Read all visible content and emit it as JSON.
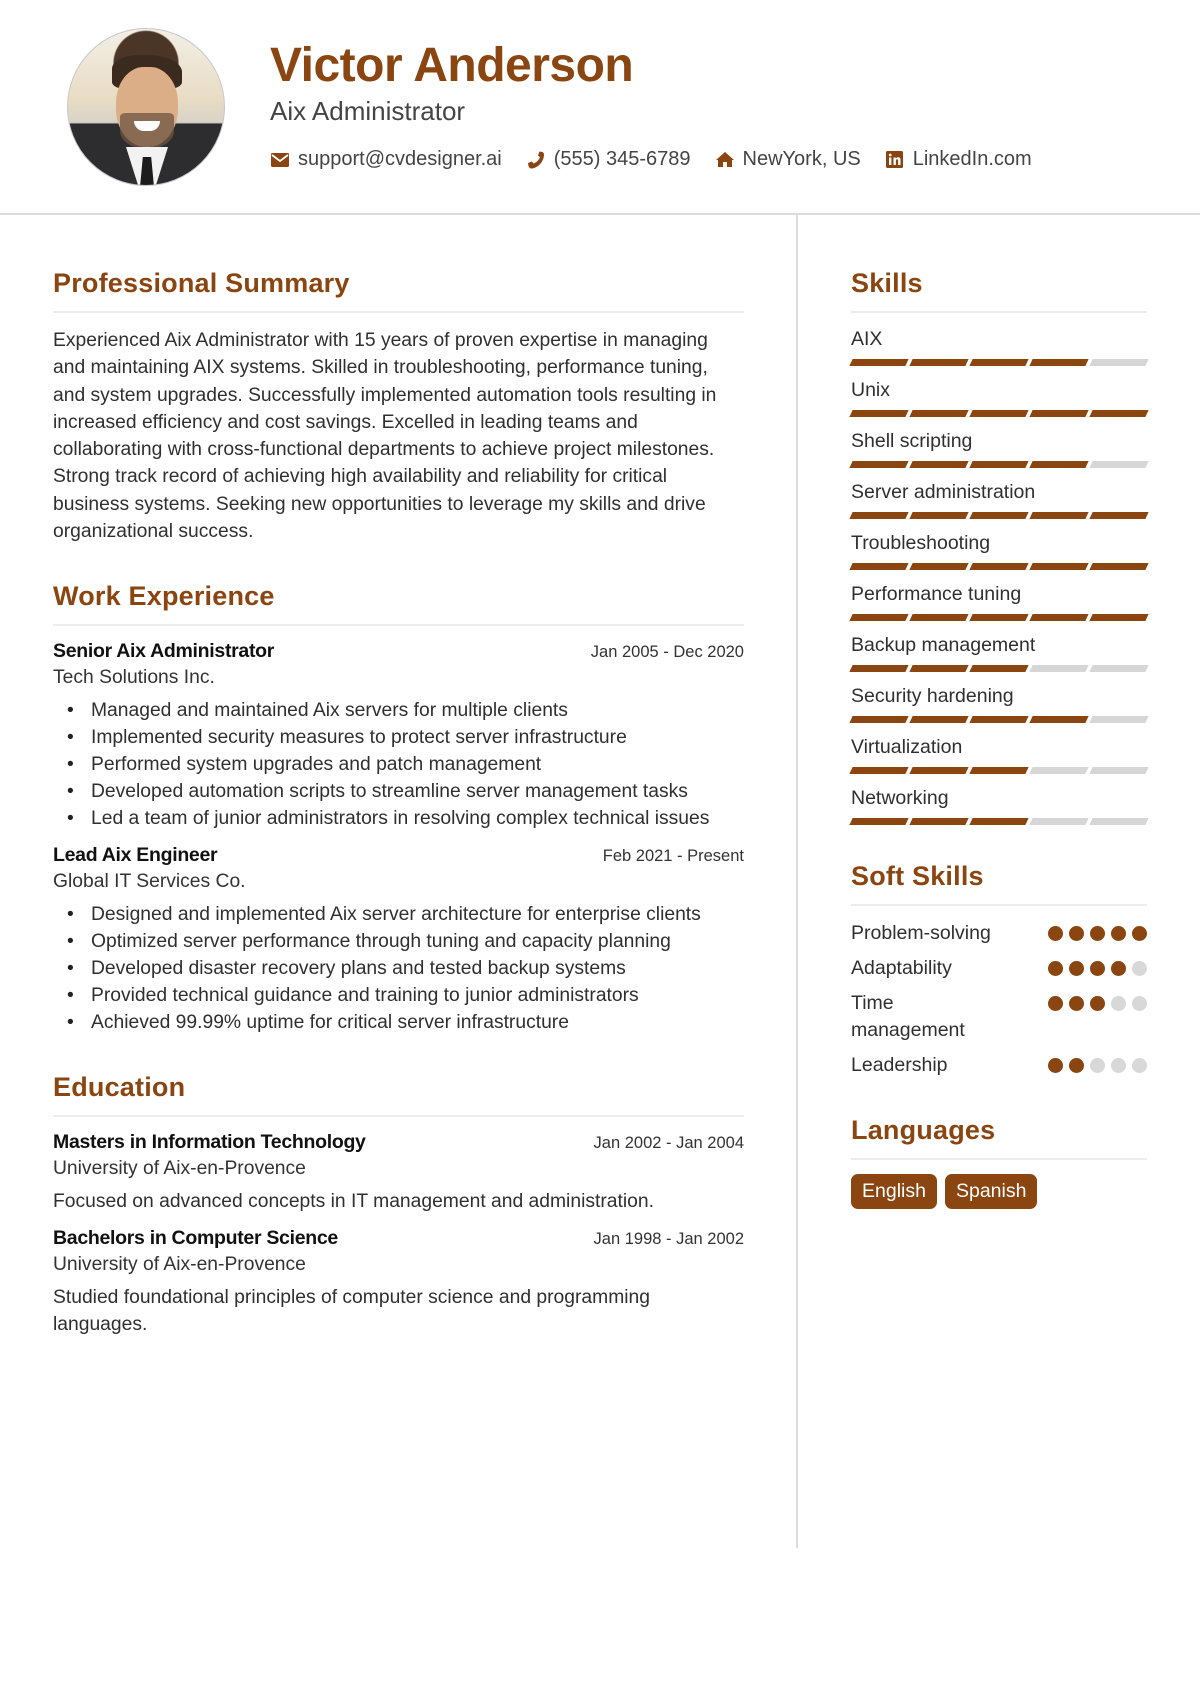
{
  "header": {
    "name": "Victor Anderson",
    "title": "Aix Administrator",
    "contacts": [
      {
        "icon": "envelope-icon",
        "text": "support@cvdesigner.ai"
      },
      {
        "icon": "phone-icon",
        "text": "(555) 345-6789"
      },
      {
        "icon": "home-icon",
        "text": "NewYork, US"
      },
      {
        "icon": "linkedin-icon",
        "text": "LinkedIn.com"
      }
    ]
  },
  "colors": {
    "accent": "#8a4511",
    "inactive": "#d6d6d6",
    "divider": "#dcdcdc"
  },
  "summary": {
    "heading": "Professional Summary",
    "text": "Experienced Aix Administrator with 15 years of proven expertise in managing and maintaining AIX systems. Skilled in troubleshooting, performance tuning, and system upgrades. Successfully implemented automation tools resulting in increased efficiency and cost savings. Excelled in leading teams and collaborating with cross-functional departments to achieve project milestones. Strong track record of achieving high availability and reliability for critical business systems. Seeking new opportunities to leverage my skills and drive organizational success."
  },
  "experience": {
    "heading": "Work Experience",
    "jobs": [
      {
        "title": "Senior Aix Administrator",
        "dates": "Jan 2005 - Dec 2020",
        "company": "Tech Solutions Inc.",
        "bullets": [
          "Managed and maintained Aix servers for multiple clients",
          "Implemented security measures to protect server infrastructure",
          "Performed system upgrades and patch management",
          "Developed automation scripts to streamline server management tasks",
          "Led a team of junior administrators in resolving complex technical issues"
        ]
      },
      {
        "title": "Lead Aix Engineer",
        "dates": "Feb 2021 - Present",
        "company": "Global IT Services Co.",
        "bullets": [
          "Designed and implemented Aix server architecture for enterprise clients",
          "Optimized server performance through tuning and capacity planning",
          "Developed disaster recovery plans and tested backup systems",
          "Provided technical guidance and training to junior administrators",
          "Achieved 99.99% uptime for critical server infrastructure"
        ]
      }
    ]
  },
  "education": {
    "heading": "Education",
    "items": [
      {
        "degree": "Masters in Information Technology",
        "dates": "Jan 2002 - Jan 2004",
        "school": "University of Aix-en-Provence",
        "description": "Focused on advanced concepts in IT management and administration."
      },
      {
        "degree": "Bachelors in Computer Science",
        "dates": "Jan 1998 - Jan 2002",
        "school": "University of Aix-en-Provence",
        "description": "Studied foundational principles of computer science and programming languages."
      }
    ]
  },
  "skills": {
    "heading": "Skills",
    "max": 5,
    "items": [
      {
        "name": "AIX",
        "level": 4
      },
      {
        "name": "Unix",
        "level": 5
      },
      {
        "name": "Shell scripting",
        "level": 4
      },
      {
        "name": "Server administration",
        "level": 5
      },
      {
        "name": "Troubleshooting",
        "level": 5
      },
      {
        "name": "Performance tuning",
        "level": 5
      },
      {
        "name": "Backup management",
        "level": 3
      },
      {
        "name": "Security hardening",
        "level": 4
      },
      {
        "name": "Virtualization",
        "level": 3
      },
      {
        "name": "Networking",
        "level": 3
      }
    ]
  },
  "soft_skills": {
    "heading": "Soft Skills",
    "max": 5,
    "items": [
      {
        "name": "Problem-solving",
        "level": 5
      },
      {
        "name": "Adaptability",
        "level": 4
      },
      {
        "name": "Time management",
        "level": 3
      },
      {
        "name": "Leadership",
        "level": 2
      }
    ]
  },
  "languages": {
    "heading": "Languages",
    "items": [
      "English",
      "Spanish"
    ]
  }
}
